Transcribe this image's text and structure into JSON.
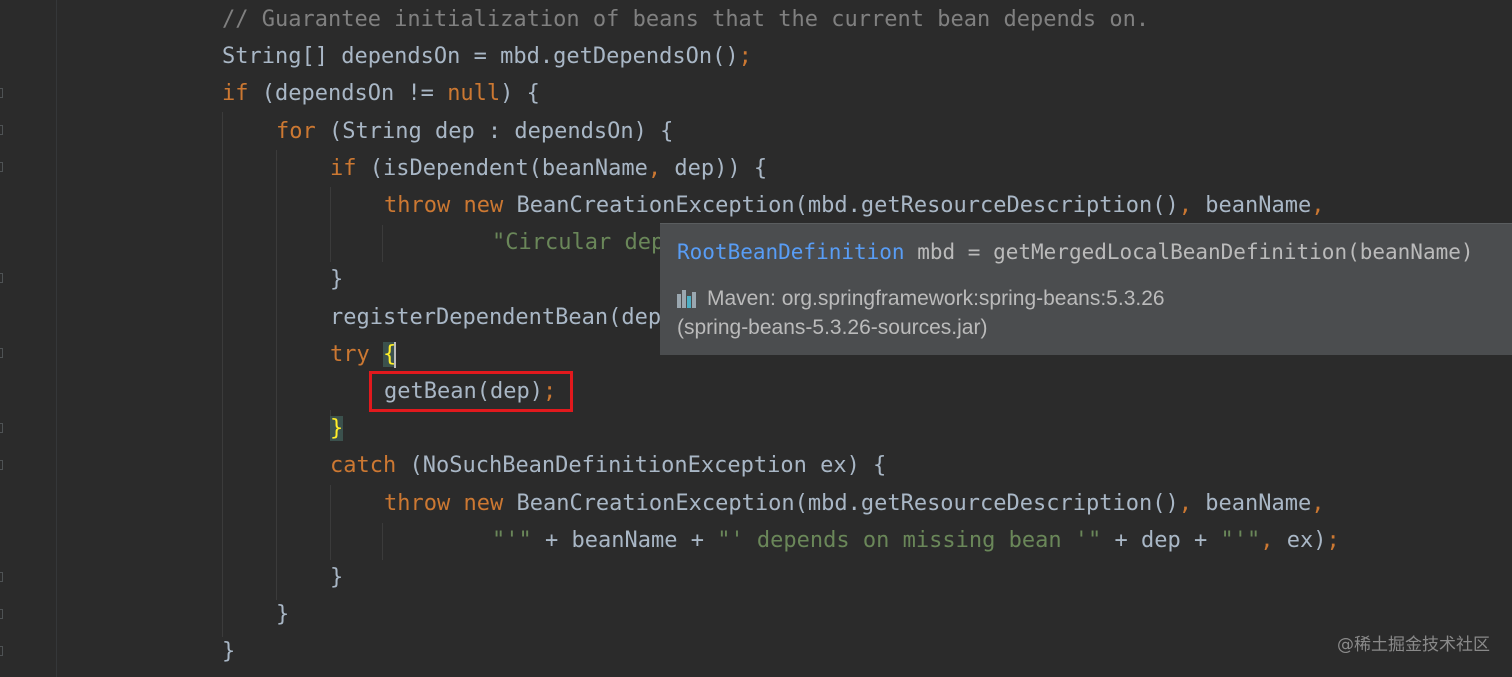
{
  "code_lines": [
    {
      "segments": [
        {
          "t": "// Guarantee initialization of beans that the current bean depends on.",
          "c": "cm"
        }
      ]
    },
    {
      "segments": [
        {
          "t": "String[] dependsOn = mbd.getDependsOn()",
          "c": ""
        },
        {
          "t": ";",
          "c": "punc"
        }
      ]
    },
    {
      "segments": [
        {
          "t": "if",
          "c": "kw"
        },
        {
          "t": " (dependsOn != ",
          "c": ""
        },
        {
          "t": "null",
          "c": "kw"
        },
        {
          "t": ") {",
          "c": ""
        }
      ]
    },
    {
      "segments": [
        {
          "t": "for",
          "c": "kw"
        },
        {
          "t": " (String dep : dependsOn) {",
          "c": ""
        }
      ]
    },
    {
      "segments": [
        {
          "t": "if",
          "c": "kw"
        },
        {
          "t": " (isDependent(beanName",
          "c": ""
        },
        {
          "t": ",",
          "c": "punc"
        },
        {
          "t": " dep)) {",
          "c": ""
        }
      ]
    },
    {
      "segments": [
        {
          "t": "throw new",
          "c": "kw"
        },
        {
          "t": " BeanCreationException(mbd.getResourceDescription()",
          "c": ""
        },
        {
          "t": ",",
          "c": "punc"
        },
        {
          "t": " beanName",
          "c": ""
        },
        {
          "t": ",",
          "c": "punc"
        }
      ]
    },
    {
      "segments": [
        {
          "t": "\"Circular dep",
          "c": "str"
        }
      ]
    },
    {
      "segments": [
        {
          "t": "}",
          "c": ""
        }
      ]
    },
    {
      "segments": [
        {
          "t": "registerDependentBean(dep",
          "c": ""
        }
      ]
    },
    {
      "segments": [
        {
          "t": "try",
          "c": "kw"
        },
        {
          "t": " ",
          "c": ""
        },
        {
          "t": "{",
          "c": "brace"
        }
      ]
    },
    {
      "segments": [
        {
          "t": "getBean(dep)",
          "c": ""
        },
        {
          "t": ";",
          "c": "punc"
        }
      ]
    },
    {
      "segments": [
        {
          "t": "}",
          "c": "brace"
        }
      ]
    },
    {
      "segments": [
        {
          "t": "catch",
          "c": "kw"
        },
        {
          "t": " (NoSuchBeanDefinitionException ex) {",
          "c": ""
        }
      ]
    },
    {
      "segments": [
        {
          "t": "throw new",
          "c": "kw"
        },
        {
          "t": " BeanCreationException(mbd.getResourceDescription()",
          "c": ""
        },
        {
          "t": ",",
          "c": "punc"
        },
        {
          "t": " beanName",
          "c": ""
        },
        {
          "t": ",",
          "c": "punc"
        }
      ]
    },
    {
      "segments": [
        {
          "t": "\"'\"",
          "c": "str"
        },
        {
          "t": " + beanName + ",
          "c": ""
        },
        {
          "t": "\"' depends on missing bean '\"",
          "c": "str"
        },
        {
          "t": " + dep + ",
          "c": ""
        },
        {
          "t": "\"'\"",
          "c": "str"
        },
        {
          "t": ",",
          "c": "punc"
        },
        {
          "t": " ex)",
          "c": ""
        },
        {
          "t": ";",
          "c": "punc"
        }
      ]
    },
    {
      "segments": [
        {
          "t": "}",
          "c": ""
        }
      ]
    },
    {
      "segments": [
        {
          "t": "}",
          "c": ""
        }
      ]
    },
    {
      "segments": [
        {
          "t": "}",
          "c": ""
        }
      ]
    }
  ],
  "popup": {
    "type_name": "RootBeanDefinition",
    "signature_rest": " mbd = getMergedLocalBeanDefinition(beanName)",
    "source_line1": "Maven: org.springframework:spring-beans:5.3.26",
    "source_line2": "(spring-beans-5.3.26-sources.jar)",
    "icon": "maven-library-icon"
  },
  "watermark": "@稀土掘金技术社区",
  "colors": {
    "background": "#2b2b2b",
    "keyword": "#cc7832",
    "string": "#6a8759",
    "comment": "#808080",
    "text": "#a9b7c6",
    "link": "#589df6",
    "highlight_border": "#e1191d"
  }
}
